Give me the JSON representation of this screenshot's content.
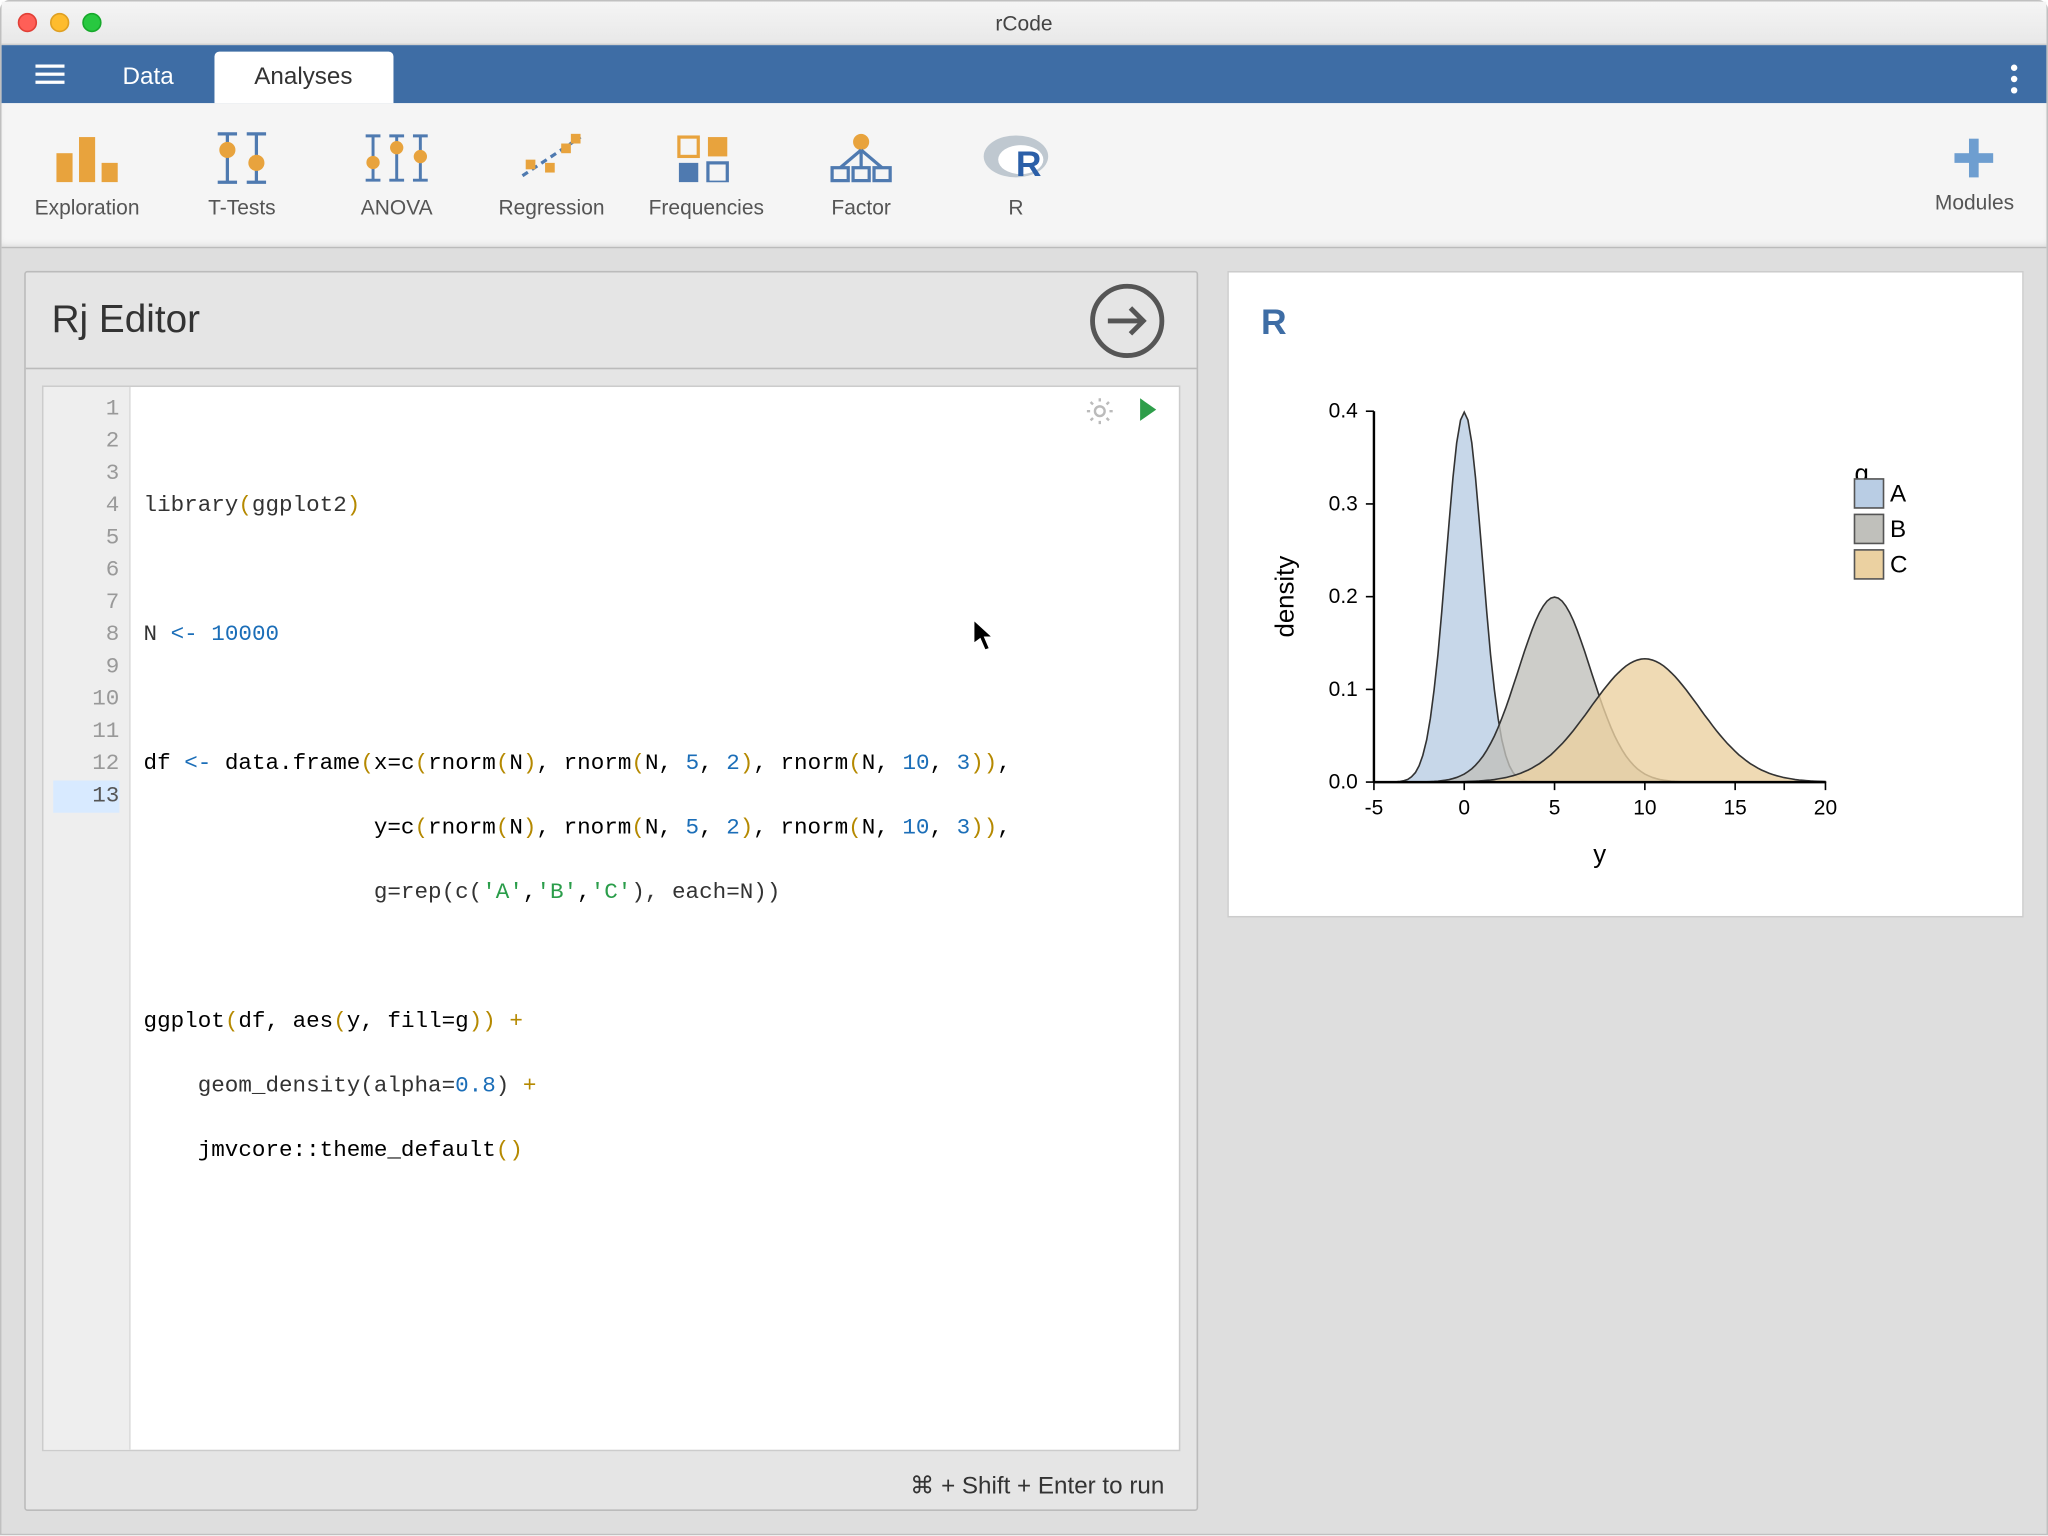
{
  "window": {
    "title": "rCode"
  },
  "tabs": {
    "data": "Data",
    "analyses": "Analyses"
  },
  "toolbar": {
    "exploration": "Exploration",
    "ttests": "T-Tests",
    "anova": "ANOVA",
    "regression": "Regression",
    "frequencies": "Frequencies",
    "factor": "Factor",
    "r": "R",
    "modules": "Modules"
  },
  "editor": {
    "title": "Rj Editor",
    "hint": "⌘ + Shift + Enter to run",
    "line_numbers": [
      "1",
      "2",
      "3",
      "4",
      "5",
      "6",
      "7",
      "8",
      "9",
      "10",
      "11",
      "12",
      "13"
    ],
    "current_line_index": 12,
    "code": {
      "l1": "",
      "l2_library": "library",
      "l2_pkg": "ggplot2",
      "l3": "",
      "l4_N": "N",
      "l4_arrow": "<-",
      "l4_val": "10000",
      "l5": "",
      "l6": "df <- data.frame(x=c(rnorm(N), rnorm(N, 5, 2), rnorm(N, 10, 3)),",
      "l7": "                 y=c(rnorm(N), rnorm(N, 5, 2), rnorm(N, 10, 3)),",
      "l8_a": "                 g=rep(c(",
      "l8_s1": "'A'",
      "l8_c1": ",",
      "l8_s2": "'B'",
      "l8_c2": ",",
      "l8_s3": "'C'",
      "l8_b": "), each=N))",
      "l9": "",
      "l10": "ggplot(df, aes(y, fill=g)) +",
      "l11_a": "    geom_density(alpha=",
      "l11_n": "0.8",
      "l11_b": ") +",
      "l12": "    jmvcore::theme_default()",
      "l13": ""
    }
  },
  "output": {
    "title": "R",
    "chart_data": {
      "type": "density",
      "xlabel": "y",
      "ylabel": "density",
      "legend_title": "g",
      "legend": [
        "A",
        "B",
        "C"
      ],
      "xlim": [
        -5,
        20
      ],
      "ylim": [
        0,
        0.4
      ],
      "xticks": [
        -5,
        0,
        5,
        10,
        15,
        20
      ],
      "yticks": [
        0.0,
        0.1,
        0.2,
        0.3,
        0.4
      ],
      "series": [
        {
          "name": "A",
          "mean": 0,
          "sd": 1,
          "color": "#b9cde4",
          "peak": 0.4
        },
        {
          "name": "B",
          "mean": 5,
          "sd": 2,
          "color": "#c0c0bb",
          "peak": 0.2
        },
        {
          "name": "C",
          "mean": 10,
          "sd": 3,
          "color": "#ebd1a1",
          "peak": 0.13
        }
      ]
    }
  }
}
